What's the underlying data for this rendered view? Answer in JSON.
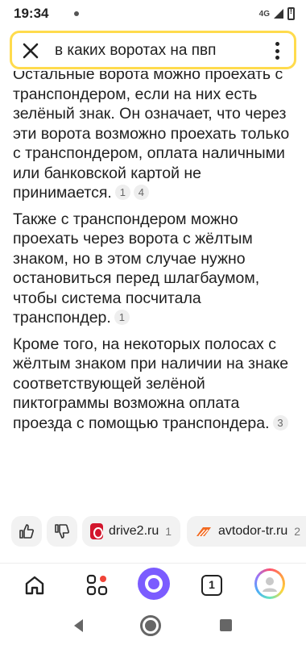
{
  "status_bar": {
    "time": "19:34",
    "network": "4G",
    "icons": [
      "notification-dot-icon",
      "signal-icon",
      "battery-alert-icon"
    ]
  },
  "search": {
    "query": "в каких воротах на пвп",
    "close_icon": "close-icon",
    "menu_icon": "more-vertical-icon",
    "border_color": "#ffdb4d"
  },
  "answer": {
    "paragraphs": [
      {
        "text": "Остальные ворота можно проехать с транспондером, если на них есть зелёный знак. Он означает, что через эти ворота возможно проехать только с транспондером, оплата наличными или банковской картой не принимается.",
        "citations": [
          "1",
          "4"
        ]
      },
      {
        "text": "Также с транспондером можно проехать через ворота с жёлтым знаком, но в этом случае нужно остановиться перед шлагбаумом, чтобы система посчитала транспондер.",
        "citations": [
          "1"
        ]
      },
      {
        "text": "Кроме того, на некоторых полосах с жёлтым знаком при наличии на знаке соответствующей зелёной пиктограммы возможна оплата проезда с помощью транспондера.",
        "citations": [
          "3"
        ]
      }
    ]
  },
  "feedback": {
    "like_icon": "thumbs-up-icon",
    "dislike_icon": "thumbs-down-icon",
    "sources": [
      {
        "label": "drive2.ru",
        "count": "1",
        "icon": "drive2-logo",
        "color": "#d3162d"
      },
      {
        "label": "avtodor-tr.ru",
        "count": "2",
        "icon": "avtodor-logo",
        "color": "#f26a21"
      }
    ]
  },
  "bottom_nav": {
    "tabs_count": "1",
    "items": [
      "home-icon",
      "services-icon",
      "alice-icon",
      "tabs-icon",
      "profile-avatar"
    ],
    "alice_color": "#7b5cff",
    "services_badge_color": "#f04438"
  },
  "system_nav": [
    "back-icon",
    "home-circle-icon",
    "recents-icon"
  ]
}
